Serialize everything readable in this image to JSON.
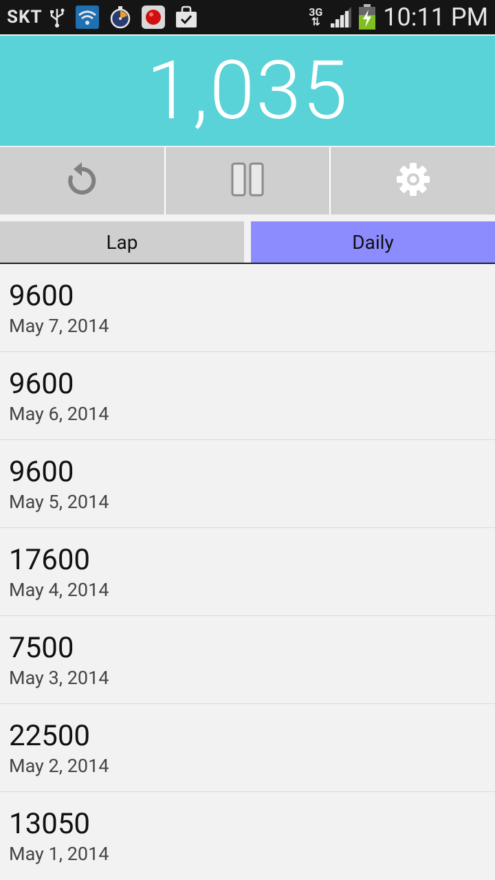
{
  "status_bar": {
    "carrier": "SKT",
    "network": "3G",
    "time": "10:11 PM",
    "icons": [
      "usb-icon",
      "wifi-icon",
      "stopwatch-icon",
      "record-icon",
      "shopping-bag-icon",
      "signal-icon",
      "battery-charging-icon"
    ]
  },
  "counter": {
    "value": "1,035"
  },
  "controls": {
    "reset": "reset-icon",
    "pause": "pause-icon",
    "settings": "gear-icon"
  },
  "tabs": [
    {
      "label": "Lap",
      "selected": false
    },
    {
      "label": "Daily",
      "selected": true
    }
  ],
  "list": [
    {
      "value": "9600",
      "date": "May 7, 2014"
    },
    {
      "value": "9600",
      "date": "May 6, 2014"
    },
    {
      "value": "9600",
      "date": "May 5, 2014"
    },
    {
      "value": "17600",
      "date": "May 4, 2014"
    },
    {
      "value": "7500",
      "date": "May 3, 2014"
    },
    {
      "value": "22500",
      "date": "May 2, 2014"
    },
    {
      "value": "13050",
      "date": "May 1, 2014"
    }
  ],
  "colors": {
    "header": "#59d2d8",
    "tab_selected": "#8c8cff",
    "tab_unselected": "#cfcfcf"
  }
}
